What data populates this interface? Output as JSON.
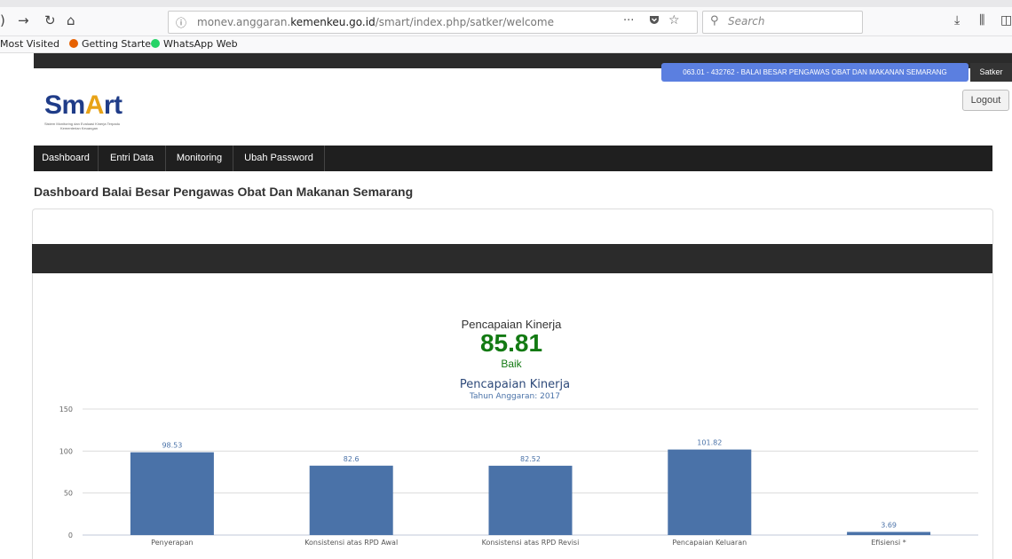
{
  "browser": {
    "url_prefix": "monev.anggaran.",
    "url_host": "kemenkeu.go.id",
    "url_path": "/smart/index.php/satker/welcome",
    "search_placeholder": "Search",
    "more_label": "···",
    "bookmarks": [
      {
        "label": "Most Visited",
        "color": ""
      },
      {
        "label": "Getting Started",
        "color": "#e66000"
      },
      {
        "label": "WhatsApp Web",
        "color": "#25d366"
      }
    ]
  },
  "header": {
    "satker_info": "063.01 - 432762 - BALAI BESAR PENGAWAS OBAT DAN MAKANAN SEMARANG",
    "satker_button": "Satker",
    "logout": "Logout",
    "logo_text": "SmArt",
    "logo_sub1": "Sistem Monitoring dan Evaluasi Kinerja Terpadu",
    "logo_sub2": "Kementerian Keuangan"
  },
  "nav": [
    "Dashboard",
    "Entri Data",
    "Monitoring",
    "Ubah Password"
  ],
  "page_title": "Dashboard Balai Besar Pengawas Obat Dan Makanan Semarang",
  "summary": {
    "label": "Pencapaian Kinerja",
    "value": "85.81",
    "status": "Baik"
  },
  "colors": {
    "bar": "#4a72a8",
    "accent_green": "#137a13",
    "satker_blue": "#5b7fe0"
  },
  "chart_data": {
    "type": "bar",
    "title": "Pencapaian Kinerja",
    "subtitle": "Tahun Anggaran: 2017",
    "categories": [
      "Penyerapan",
      "Konsistensi atas RPD Awal",
      "Konsistensi atas RPD Revisi",
      "Pencapaian Keluaran",
      "Efisiensi *"
    ],
    "values": [
      98.53,
      82.6,
      82.52,
      101.82,
      3.69
    ],
    "value_labels": [
      "98.53",
      "82.6",
      "82.52",
      "101.82",
      "3.69"
    ],
    "ylim": [
      0,
      150
    ],
    "yticks": [
      0,
      50,
      100,
      150
    ],
    "grid": true,
    "legend": "none"
  }
}
